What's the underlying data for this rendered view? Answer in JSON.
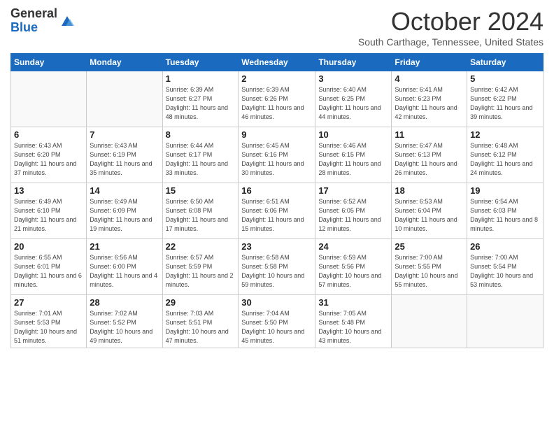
{
  "logo": {
    "general": "General",
    "blue": "Blue"
  },
  "title": "October 2024",
  "subtitle": "South Carthage, Tennessee, United States",
  "days_of_week": [
    "Sunday",
    "Monday",
    "Tuesday",
    "Wednesday",
    "Thursday",
    "Friday",
    "Saturday"
  ],
  "weeks": [
    [
      {
        "day": "",
        "info": ""
      },
      {
        "day": "",
        "info": ""
      },
      {
        "day": "1",
        "info": "Sunrise: 6:39 AM\nSunset: 6:27 PM\nDaylight: 11 hours and 48 minutes."
      },
      {
        "day": "2",
        "info": "Sunrise: 6:39 AM\nSunset: 6:26 PM\nDaylight: 11 hours and 46 minutes."
      },
      {
        "day": "3",
        "info": "Sunrise: 6:40 AM\nSunset: 6:25 PM\nDaylight: 11 hours and 44 minutes."
      },
      {
        "day": "4",
        "info": "Sunrise: 6:41 AM\nSunset: 6:23 PM\nDaylight: 11 hours and 42 minutes."
      },
      {
        "day": "5",
        "info": "Sunrise: 6:42 AM\nSunset: 6:22 PM\nDaylight: 11 hours and 39 minutes."
      }
    ],
    [
      {
        "day": "6",
        "info": "Sunrise: 6:43 AM\nSunset: 6:20 PM\nDaylight: 11 hours and 37 minutes."
      },
      {
        "day": "7",
        "info": "Sunrise: 6:43 AM\nSunset: 6:19 PM\nDaylight: 11 hours and 35 minutes."
      },
      {
        "day": "8",
        "info": "Sunrise: 6:44 AM\nSunset: 6:17 PM\nDaylight: 11 hours and 33 minutes."
      },
      {
        "day": "9",
        "info": "Sunrise: 6:45 AM\nSunset: 6:16 PM\nDaylight: 11 hours and 30 minutes."
      },
      {
        "day": "10",
        "info": "Sunrise: 6:46 AM\nSunset: 6:15 PM\nDaylight: 11 hours and 28 minutes."
      },
      {
        "day": "11",
        "info": "Sunrise: 6:47 AM\nSunset: 6:13 PM\nDaylight: 11 hours and 26 minutes."
      },
      {
        "day": "12",
        "info": "Sunrise: 6:48 AM\nSunset: 6:12 PM\nDaylight: 11 hours and 24 minutes."
      }
    ],
    [
      {
        "day": "13",
        "info": "Sunrise: 6:49 AM\nSunset: 6:10 PM\nDaylight: 11 hours and 21 minutes."
      },
      {
        "day": "14",
        "info": "Sunrise: 6:49 AM\nSunset: 6:09 PM\nDaylight: 11 hours and 19 minutes."
      },
      {
        "day": "15",
        "info": "Sunrise: 6:50 AM\nSunset: 6:08 PM\nDaylight: 11 hours and 17 minutes."
      },
      {
        "day": "16",
        "info": "Sunrise: 6:51 AM\nSunset: 6:06 PM\nDaylight: 11 hours and 15 minutes."
      },
      {
        "day": "17",
        "info": "Sunrise: 6:52 AM\nSunset: 6:05 PM\nDaylight: 11 hours and 12 minutes."
      },
      {
        "day": "18",
        "info": "Sunrise: 6:53 AM\nSunset: 6:04 PM\nDaylight: 11 hours and 10 minutes."
      },
      {
        "day": "19",
        "info": "Sunrise: 6:54 AM\nSunset: 6:03 PM\nDaylight: 11 hours and 8 minutes."
      }
    ],
    [
      {
        "day": "20",
        "info": "Sunrise: 6:55 AM\nSunset: 6:01 PM\nDaylight: 11 hours and 6 minutes."
      },
      {
        "day": "21",
        "info": "Sunrise: 6:56 AM\nSunset: 6:00 PM\nDaylight: 11 hours and 4 minutes."
      },
      {
        "day": "22",
        "info": "Sunrise: 6:57 AM\nSunset: 5:59 PM\nDaylight: 11 hours and 2 minutes."
      },
      {
        "day": "23",
        "info": "Sunrise: 6:58 AM\nSunset: 5:58 PM\nDaylight: 10 hours and 59 minutes."
      },
      {
        "day": "24",
        "info": "Sunrise: 6:59 AM\nSunset: 5:56 PM\nDaylight: 10 hours and 57 minutes."
      },
      {
        "day": "25",
        "info": "Sunrise: 7:00 AM\nSunset: 5:55 PM\nDaylight: 10 hours and 55 minutes."
      },
      {
        "day": "26",
        "info": "Sunrise: 7:00 AM\nSunset: 5:54 PM\nDaylight: 10 hours and 53 minutes."
      }
    ],
    [
      {
        "day": "27",
        "info": "Sunrise: 7:01 AM\nSunset: 5:53 PM\nDaylight: 10 hours and 51 minutes."
      },
      {
        "day": "28",
        "info": "Sunrise: 7:02 AM\nSunset: 5:52 PM\nDaylight: 10 hours and 49 minutes."
      },
      {
        "day": "29",
        "info": "Sunrise: 7:03 AM\nSunset: 5:51 PM\nDaylight: 10 hours and 47 minutes."
      },
      {
        "day": "30",
        "info": "Sunrise: 7:04 AM\nSunset: 5:50 PM\nDaylight: 10 hours and 45 minutes."
      },
      {
        "day": "31",
        "info": "Sunrise: 7:05 AM\nSunset: 5:48 PM\nDaylight: 10 hours and 43 minutes."
      },
      {
        "day": "",
        "info": ""
      },
      {
        "day": "",
        "info": ""
      }
    ]
  ]
}
